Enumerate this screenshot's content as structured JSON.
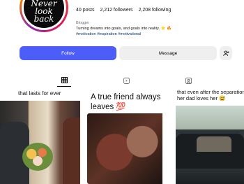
{
  "profile": {
    "avatar_text": "Never look back",
    "posts": "40 posts",
    "followers": "2,212 followers",
    "following": "2,208 following",
    "category": "Blogger",
    "bio": "Turning dreams into goals, and goals into reality. ⭐ 🔥",
    "hashtags": "#motivation #inspiration #motivational"
  },
  "actions": {
    "follow_label": "Follow",
    "message_label": "Message",
    "suggest_icon": "add-person-icon"
  },
  "tabs": [
    {
      "name": "posts",
      "icon": "grid-icon",
      "selected": true
    },
    {
      "name": "reels",
      "icon": "reels-icon",
      "selected": false
    },
    {
      "name": "tagged",
      "icon": "tagged-icon",
      "selected": false
    }
  ],
  "grid": [
    {
      "caption": "that lasts for ever"
    },
    {
      "caption": "A true friend always leaves 💯"
    },
    {
      "caption_line1": "that even after the separation,",
      "caption_line2": "her dad loves her 😅"
    }
  ],
  "colors": {
    "follow_button": "#4c5ef7",
    "secondary_button": "#efefef",
    "hashtag": "#00376b"
  }
}
